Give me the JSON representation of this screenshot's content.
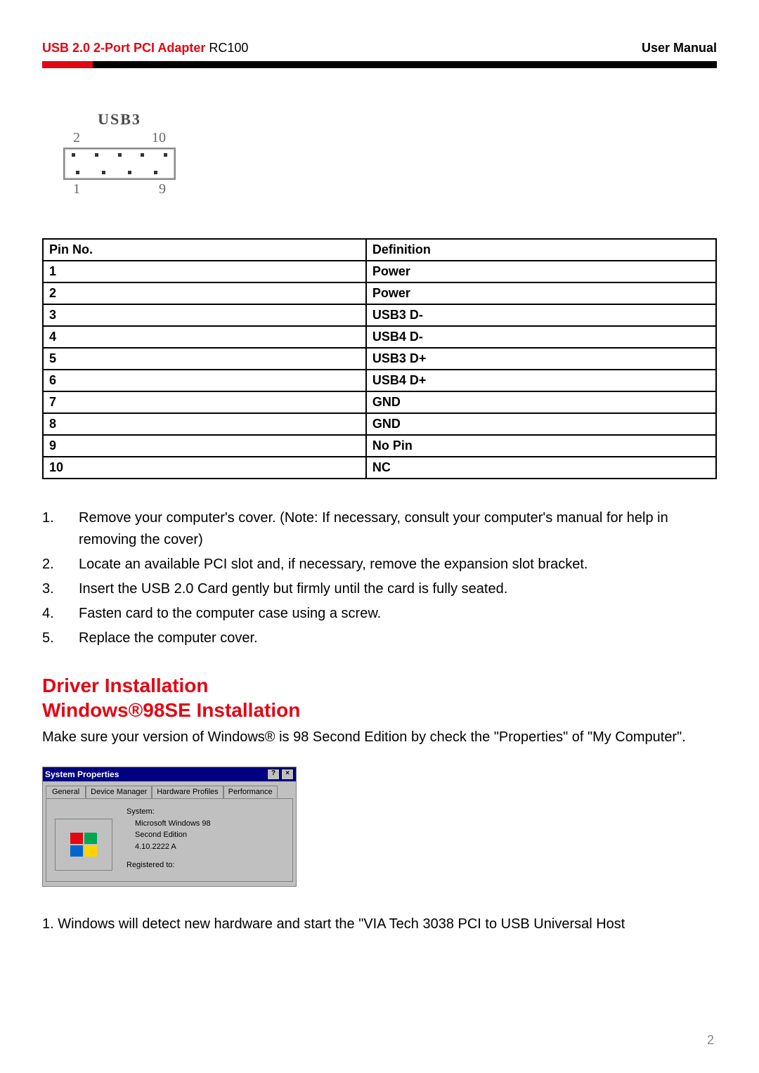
{
  "header": {
    "product_red": "USB 2.0 2-Port PCI Adapter ",
    "product_model": "RC100",
    "right_label": "User Manual"
  },
  "usb3_diagram": {
    "title": "USB3",
    "top_left": "2",
    "top_right": "10",
    "bottom_left": "1",
    "bottom_right": "9"
  },
  "pin_table": {
    "headers": {
      "pin": "Pin No.",
      "def": "Definition"
    },
    "rows": [
      {
        "pin": "1",
        "def": "Power"
      },
      {
        "pin": "2",
        "def": "Power"
      },
      {
        "pin": "3",
        "def": "USB3 D-"
      },
      {
        "pin": "4",
        "def": "USB4 D-"
      },
      {
        "pin": "5",
        "def": "USB3 D+"
      },
      {
        "pin": "6",
        "def": "USB4 D+"
      },
      {
        "pin": "7",
        "def": "GND"
      },
      {
        "pin": "8",
        "def": "GND"
      },
      {
        "pin": "9",
        "def": "No Pin"
      },
      {
        "pin": "10",
        "def": "NC"
      }
    ]
  },
  "instructions": [
    {
      "n": "1.",
      "t": "Remove your computer's cover. (Note: If necessary, consult your computer's manual for help in removing the cover)"
    },
    {
      "n": "2.",
      "t": "Locate an available PCI slot and, if necessary, remove the expansion slot bracket."
    },
    {
      "n": "3.",
      "t": "Insert the USB 2.0 Card gently but firmly until the card is fully seated."
    },
    {
      "n": "4.",
      "t": "Fasten card to the computer case using a screw."
    },
    {
      "n": "5.",
      "t": "Replace the computer cover."
    }
  ],
  "section": {
    "heading_line1": "Driver Installation",
    "heading_line2": "Windows®98SE Installation",
    "intro": "Make sure your version of Windows® is 98 Second Edition by check the \"Properties\" of \"My Computer\"."
  },
  "win98_dialog": {
    "title": "System Properties",
    "help_btn": "?",
    "close_btn": "×",
    "tabs": {
      "general": "General",
      "device_manager": "Device Manager",
      "hardware_profiles": "Hardware Profiles",
      "performance": "Performance"
    },
    "system_label": "System:",
    "system_line1": "Microsoft Windows 98",
    "system_line2": "Second Edition",
    "system_line3": "4.10.2222 A",
    "registered_label": "Registered to:"
  },
  "bottom_step": "1. Windows will detect new hardware and start the \"VIA Tech 3038 PCI to USB Universal Host",
  "page_number": "2"
}
